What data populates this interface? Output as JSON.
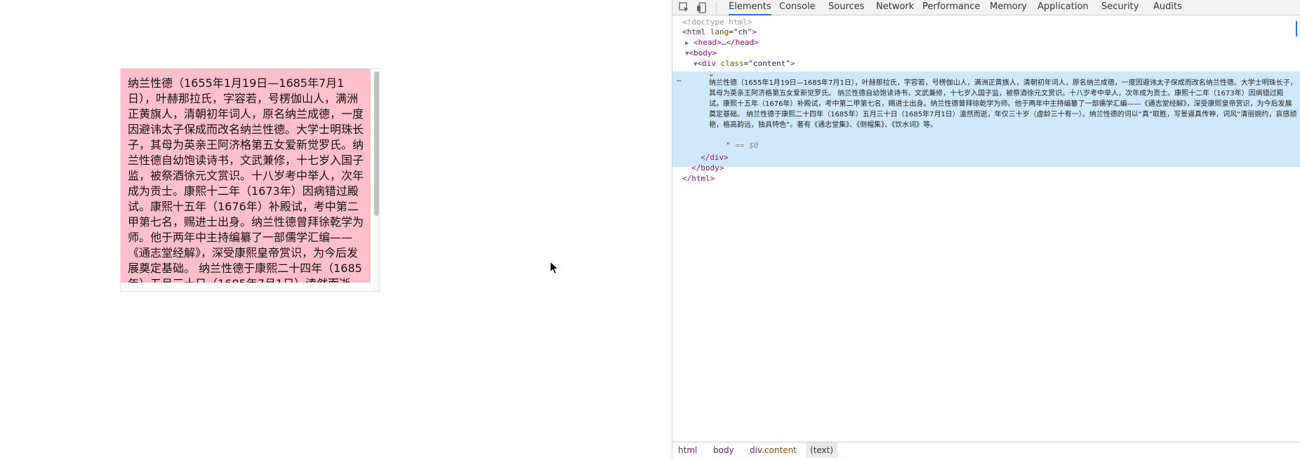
{
  "page": {
    "content_text": "纳兰性德（1655年1月19日—1685年7月1日），叶赫那拉氏，字容若，号楞伽山人，满洲正黄旗人，清朝初年词人，原名纳兰成德，一度因避讳太子保成而改名纳兰性德。大学士明珠长子，其母为英亲王阿济格第五女爱新觉罗氏。纳兰性德自幼饱读诗书，文武兼修，十七岁入国子监，被祭酒徐元文赏识。十八岁考中举人，次年成为贡士。康熙十二年（1673年）因病错过殿试。康熙十五年（1676年）补殿试，考中第二甲第七名，赐进士出身。纳兰性德曾拜徐乾学为师。他于两年中主持编纂了一部儒学汇编——《通志堂经解》，深受康熙皇帝赏识，为今后发展奠定基础。 纳兰性德于康熙二十四年（1685年）五月三十日（1685年7月1日）溘然而逝，年仅三十岁（虚龄三十有一）。"
  },
  "devtools": {
    "tabs": [
      {
        "label": "Elements",
        "active": true
      },
      {
        "label": "Console"
      },
      {
        "label": "Sources"
      },
      {
        "label": "Network"
      },
      {
        "label": "Performance"
      },
      {
        "label": "Memory"
      },
      {
        "label": "Application"
      },
      {
        "label": "Security"
      },
      {
        "label": "Audits"
      }
    ],
    "dom": {
      "doctype": "<!doctype html>",
      "html_open_tag": "html",
      "html_attr_name": "lang",
      "html_attr_value": "\"ch\"",
      "head_collapsed": "<head>…</head>",
      "body_tag": "body",
      "div_tag": "div",
      "div_attr_name": "class",
      "div_attr_value": "\"content\"",
      "text_node": "纳兰性德（1655年1月19日—1685年7月1日），叶赫那拉氏，字容若，号楞伽山人，满洲正黄旗人，清朝初年词人，原名纳兰成德，一度因避讳太子保成而改名纳兰性德。大学士明珠长子，其母为英亲王阿济格第五女爱新觉罗氏。 纳兰性德自幼饱读诗书，文武兼修，十七岁入国子监，被祭酒徐元文赏识。十八岁考中举人，次年成为贡士。康熙十二年（1673年）因病错过殿试。康熙十五年（1676年）补殿试，考中第二甲第七名，赐进士出身。纳兰性德曾拜徐乾学为师。他于两年中主持编纂了一部儒学汇编——《通志堂经解》，深受康熙皇帝赏识，为今后发展奠定基础。 纳兰性德于康熙二十四年（1685年）五月三十日（1685年7月1日）溘然而逝，年仅三十岁（虚龄三十有一）。纳兰性德的词以“真”取胜，写景逼真传神，词风“清丽婉约，哀感顽艳，格高韵远，独具特色”。著有《通志堂集》、《侧帽集》、《饮水词》等。",
      "selected_marker": "== $0",
      "div_close": "</div>",
      "body_close": "</body>",
      "html_close": "</html>",
      "ellipsis": "…"
    },
    "breadcrumb": {
      "html": "html",
      "body": "body",
      "div_tag": "div",
      "div_class": ".content",
      "text": "(text)"
    },
    "icons": {
      "inspect": "inspect-element-icon",
      "device": "device-toolbar-icon"
    },
    "accent_color": "#1a73e8"
  }
}
